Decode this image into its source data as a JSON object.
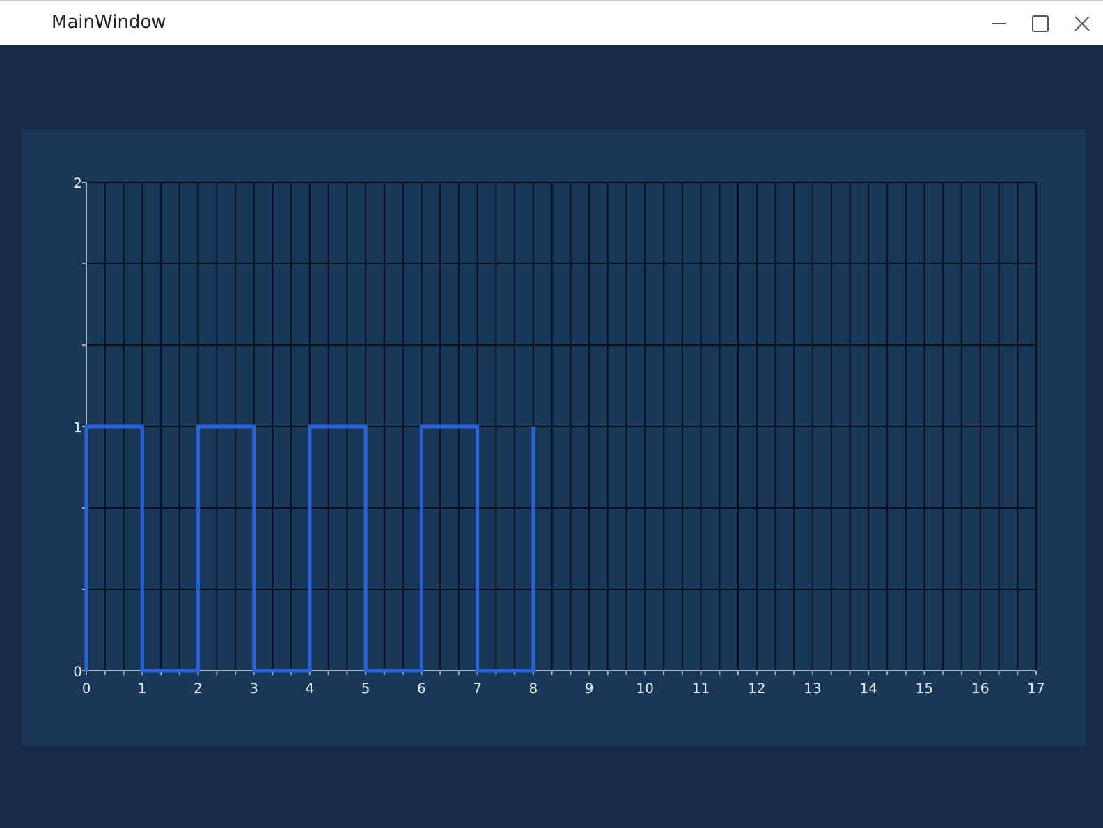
{
  "window": {
    "title": "MainWindow"
  },
  "chart": {
    "chart_data": {
      "type": "line",
      "x": [
        0,
        0,
        1,
        1,
        2,
        2,
        3,
        3,
        4,
        4,
        5,
        5,
        6,
        6,
        7,
        7,
        8,
        8
      ],
      "series": [
        {
          "color": "#2563e0",
          "values": [
            0,
            1,
            1,
            0,
            0,
            1,
            1,
            0,
            0,
            1,
            1,
            0,
            0,
            1,
            1,
            0,
            0,
            1
          ]
        }
      ],
      "xlim": [
        0,
        17
      ],
      "ylim": [
        0,
        2
      ],
      "xticks": [
        0,
        1,
        2,
        3,
        4,
        5,
        6,
        7,
        8,
        9,
        10,
        11,
        12,
        13,
        14,
        15,
        16,
        17
      ],
      "yticks": [
        0,
        1,
        2
      ],
      "grid": true
    }
  }
}
